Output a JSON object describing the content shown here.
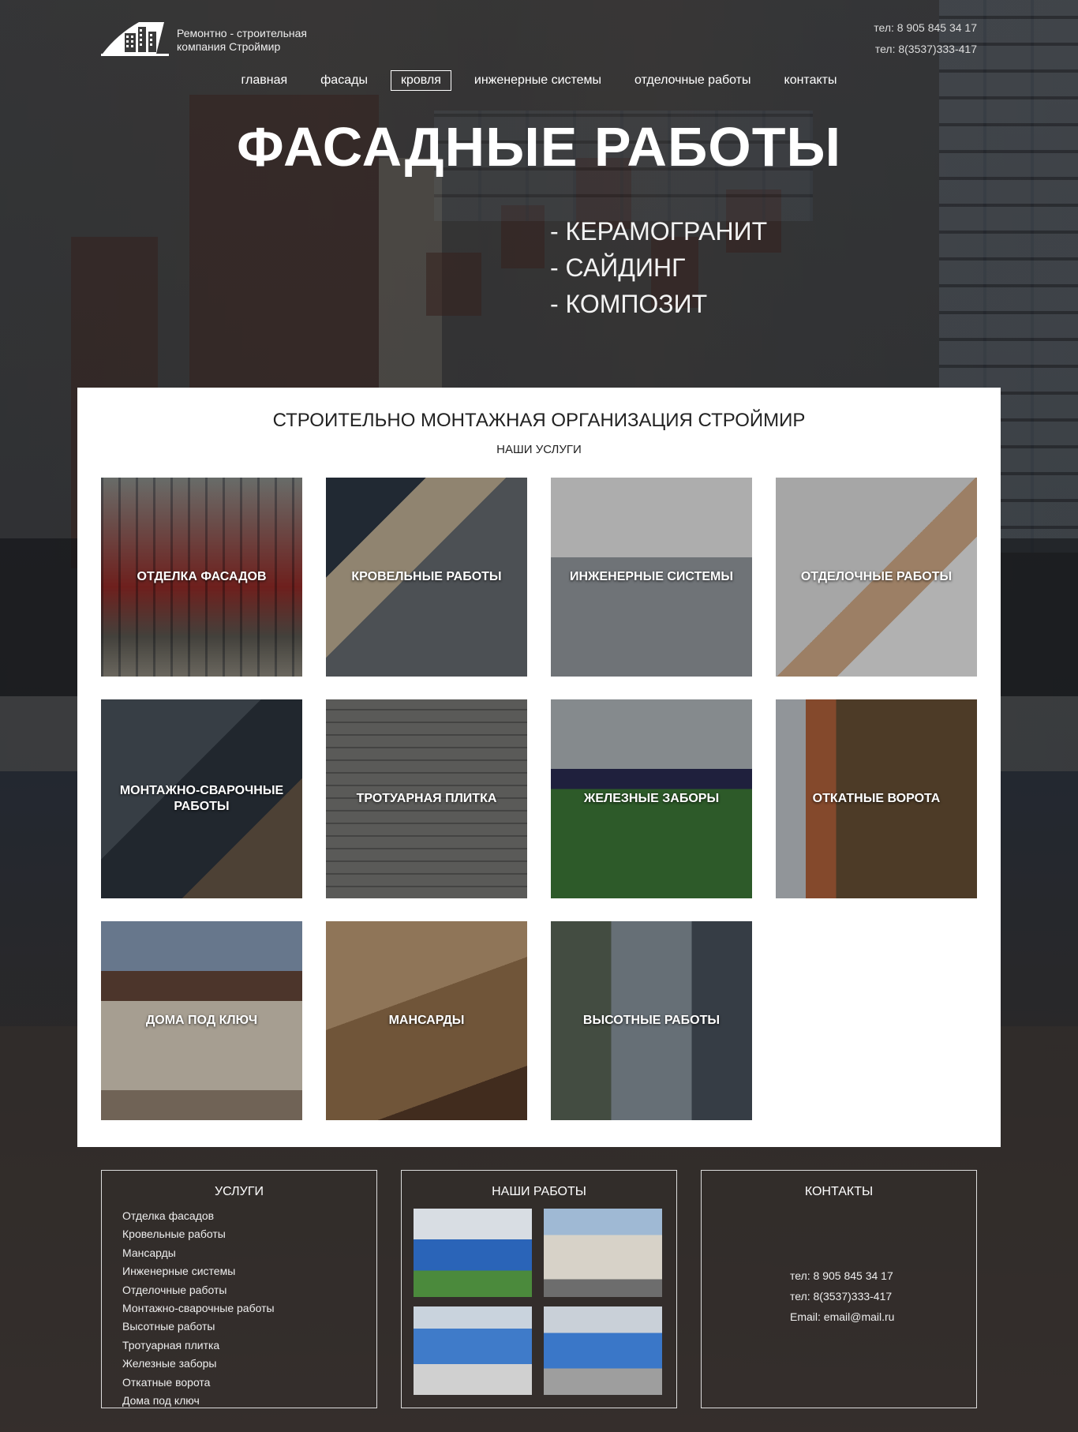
{
  "header": {
    "logo_text_line1": "Ремонтно - строительная",
    "logo_text_line2": "компания Строймир",
    "phone1": "тел: 8 905 845 34 17",
    "phone2": "тел: 8(3537)333-417"
  },
  "nav": {
    "items": [
      "главная",
      "фасады",
      "кровля",
      "инженерные системы",
      "отделочные работы",
      "контакты"
    ],
    "active": "кровля"
  },
  "hero": {
    "title": "ФАСАДНЫЕ РАБОТЫ",
    "list": [
      "- КЕРАМОГРАНИТ",
      "- САЙДИНГ",
      "- КОМПОЗИТ"
    ]
  },
  "main": {
    "title": "СТРОИТЕЛЬНО МОНТАЖНАЯ ОРГАНИЗАЦИЯ СТРОЙМИР",
    "subtitle": "НАШИ УСЛУГИ",
    "tiles": [
      {
        "label": "ОТДЕЛКА ФАСАДОВ"
      },
      {
        "label": "КРОВЕЛЬНЫЕ РАБОТЫ"
      },
      {
        "label": "ИНЖЕНЕРНЫЕ СИСТЕМЫ"
      },
      {
        "label": "ОТДЕЛОЧНЫЕ РАБОТЫ"
      },
      {
        "label": "МОНТАЖНО-СВАРОЧНЫЕ РАБОТЫ"
      },
      {
        "label": "ТРОТУАРНАЯ ПЛИТКА"
      },
      {
        "label": "ЖЕЛЕЗНЫЕ ЗАБОРЫ"
      },
      {
        "label": "ОТКАТНЫЕ ВОРОТА"
      },
      {
        "label": "ДОМА ПОД КЛЮЧ"
      },
      {
        "label": "МАНСАРДЫ"
      },
      {
        "label": "ВЫСОТНЫЕ РАБОТЫ"
      }
    ]
  },
  "footer": {
    "services_title": "УСЛУГИ",
    "services": [
      "Отделка фасадов",
      "Кровельные работы",
      "Мансарды",
      "Инженерные системы",
      "Отделочные работы",
      "Монтажно-сварочные работы",
      "Высотные работы",
      "Тротуарная плитка",
      "Железные заборы",
      "Откатные ворота",
      "Дома под ключ"
    ],
    "works_title": "НАШИ РАБОТЫ",
    "contacts_title": "КОНТАКТЫ",
    "contact_phone1": "тел: 8 905 845 34 17",
    "contact_phone2": "тел: 8(3537)333-417",
    "contact_email": "Email: email@mail.ru"
  }
}
